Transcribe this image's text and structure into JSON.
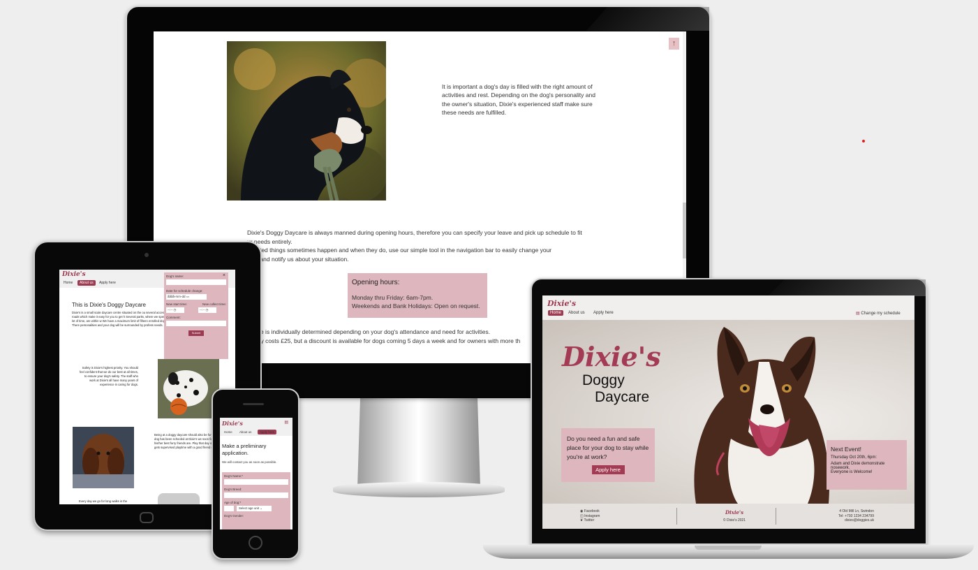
{
  "desktop": {
    "paragraph1": "It is important a dog's day is filled with the right amount of activities and rest. Depending on the dog's personality and the owner's situation, Dixie's experienced staff make sure these needs are fulfilled.",
    "paragraph2_line1": "Dixie's Doggy Daycare is always manned during opening hours, therefore you can specify your leave and pick up schedule to fit",
    "paragraph2_line2": "ur needs entirely.",
    "paragraph2_line3": "xpected things sometimes happen and when they do, use our simple tool in the navigation bar to easily change your",
    "paragraph2_line4": "dule and notify us about your situation.",
    "hours_title": "Opening hours:",
    "hours_line1": "Monday thru Friday: 6am-7pm.",
    "hours_line2": "Weekends and Bank Holidays: Open on request.",
    "price_line1": "rice is individually determined depending on your dog's attendance and need for activities.",
    "price_line2": "day costs £25, but a discount is available for dogs coming 5 days a week and for owners with more th",
    "up_icon": "arrow-up-icon"
  },
  "tablet": {
    "logo": "Dixie's",
    "nav": [
      "Home",
      "About us",
      "Apply here"
    ],
    "heading": "This is Dixie's Doggy Daycare",
    "intro": "Dixie's is a small scale daycare centre situated on the ou several access roads which make it easy for you to get h Several parks, where we spend a lot of time, are within w We have a maximum limit of fifteen enrolled dogs. There personalities and your dog will be surrounded by profess needs.",
    "safety": "Safety is Dixie's highest priority. You should feel confident that we do our best at all times, to ensure your dog's safety. The staff who work at Dixie's all have many years of experience in caring for dogs.",
    "fun": "Being at a doggy daycare should also be fun. Once your dog has been schooled at Dixie's we soon find out who his/her best furry friends are. Play that day on your dog gets supervised playtime with a good friend every day.",
    "walks": "Every day we go for long walks in the",
    "form": {
      "dog_name_label": "Dog's name:",
      "date_label": "Date for schedule change:",
      "date_placeholder": "åååå-mm-dd",
      "start_label": "New start time:",
      "collect_label": "New collect time:",
      "time_placeholder": "--:--",
      "comment_label": "Comment:",
      "submit": "Submit",
      "close": "×"
    }
  },
  "phone": {
    "logo": "Dixie's",
    "nav": [
      "Home",
      "About us",
      "Apply here"
    ],
    "heading": "Make a preliminary application.",
    "subtext": "We will contact you as soon as possible.",
    "form": {
      "name_label": "Dog's Name:*",
      "breed_label": "Dog's Breed:",
      "age_label": "Age of dog:*",
      "age_select": "Select age unit",
      "gender_label": "Dog's Gender:"
    }
  },
  "laptop": {
    "logo": "Dixie's",
    "nav": [
      "Home",
      "About us",
      "Apply here"
    ],
    "change_schedule": "Change my schedule",
    "hero_title_script": "Dixie's",
    "hero_title_line1": "Doggy",
    "hero_title_line2": "Daycare",
    "cta_text": "Do you need a fun and safe place for your dog to stay while you're at work?",
    "cta_button": "Apply here",
    "event_title": "Next Event!",
    "event_date": "Thursday Oct 20th, 6pm:",
    "event_desc": "Adam and Dixie demonstrate nosework.",
    "event_welcome": "Everyone is Welcome!",
    "footer": {
      "social": [
        "Facebook",
        "Instagram",
        "Twitter"
      ],
      "logo": "Dixie's",
      "copyright": "© Dixie's 2021",
      "address": "4 Old Mill Ln, Swindon",
      "phone": "Tel: +793 1234 234799",
      "email": "dixies@doggies.uk"
    }
  },
  "colors": {
    "brand": "#9b3a50",
    "pink_box": "#ddb7bd"
  }
}
